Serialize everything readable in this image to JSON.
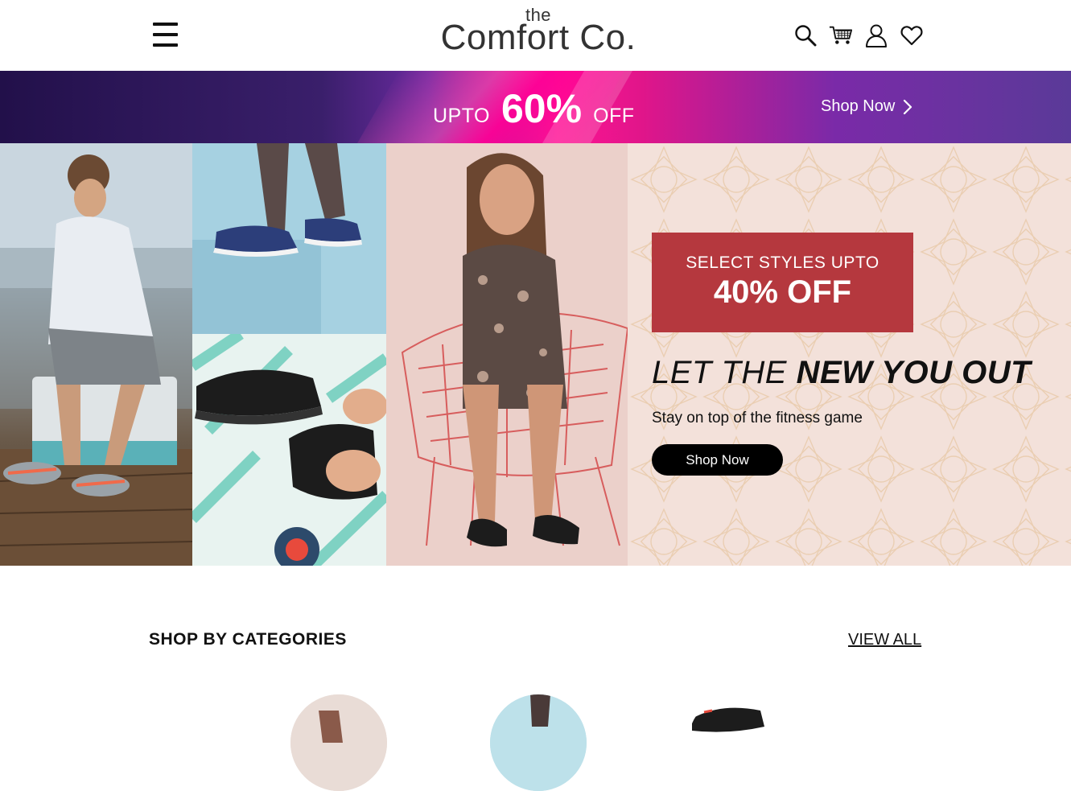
{
  "header": {
    "logo_small": "the",
    "logo_name": "Comfort Co.",
    "icons": [
      "search-icon",
      "cart-icon",
      "account-icon",
      "heart-icon"
    ]
  },
  "promo": {
    "prefix": "UPTO",
    "percent": "60%",
    "suffix": "OFF",
    "shop_label": "Shop Now"
  },
  "hero": {
    "offer_line1": "SELECT STYLES UPTO",
    "offer_line2": "40% OFF",
    "tagline_light": "LET THE ",
    "tagline_bold": "NEW YOU OUT",
    "subline": "Stay on top of the fitness game",
    "button_label": "Shop Now"
  },
  "categories": {
    "title": "SHOP BY CATEGORIES",
    "view_all": "VIEW ALL"
  },
  "colors": {
    "offer_box": "#b5383e",
    "promo_pink": "#ff1493",
    "promo_purple": "#3a1f6b"
  }
}
